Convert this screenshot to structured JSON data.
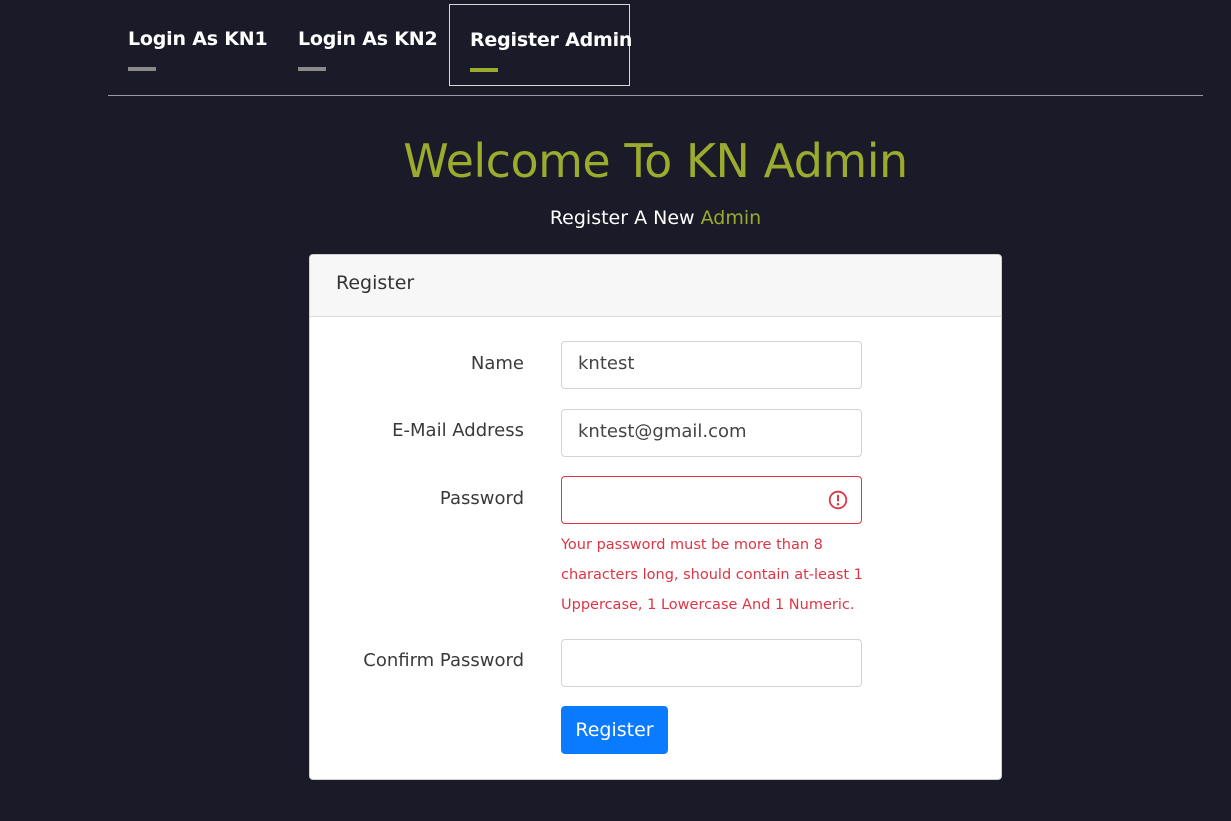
{
  "nav": {
    "items": [
      {
        "label": "Login As KN1"
      },
      {
        "label": "Login As KN2"
      },
      {
        "label": "Register Admin"
      }
    ]
  },
  "hero": {
    "title": "Welcome To KN Admin",
    "subtitle_prefix": "Register A New ",
    "subtitle_accent": "Admin"
  },
  "card": {
    "header": "Register",
    "fields": {
      "name": {
        "label": "Name",
        "value": "kntest"
      },
      "email": {
        "label": "E-Mail Address",
        "value": "kntest@gmail.com"
      },
      "password": {
        "label": "Password",
        "value": ""
      },
      "confirm": {
        "label": "Confirm Password",
        "value": ""
      }
    },
    "error": {
      "line1": "Your password must be more than 8",
      "line2": "characters long, should contain at-least 1",
      "line3": "Uppercase, 1 Lowercase And 1 Numeric."
    },
    "submit_label": "Register"
  },
  "colors": {
    "background": "#1a1a28",
    "accent": "#9aab2e",
    "error": "#dc3545",
    "primary_button": "#0a7bff"
  },
  "icons": {
    "password_status": "alert-circle-icon"
  }
}
